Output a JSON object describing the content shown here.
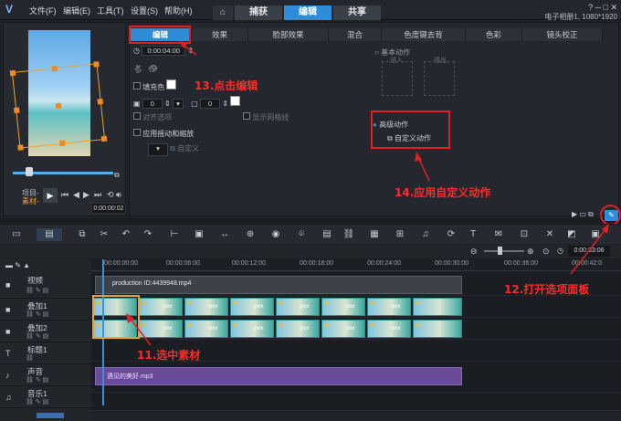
{
  "app": {
    "title_info": "电子相册1, 1080*1920"
  },
  "menu": [
    "文件(F)",
    "编辑(E)",
    "工具(T)",
    "设置(S)",
    "帮助(H)"
  ],
  "main_tabs": [
    "捕获",
    "编辑",
    "共享"
  ],
  "preview": {
    "project_label": "项目-",
    "clip_label": "素材-",
    "timecode": "0:00:00:02"
  },
  "options": {
    "subtabs": [
      "编辑",
      "效果",
      "脸部效果",
      "混合",
      "色度键去背",
      "色彩",
      "镜头校正"
    ],
    "duration": "0:00:04:00",
    "fill_color_label": "填充色",
    "value_a": "0",
    "value_b": "0",
    "align_label": "对齐选项",
    "grid_label": "显示网格线",
    "pan_zoom_label": "应用摇动和缩放",
    "custom_label": "自定义",
    "basic_motion": "基本动作",
    "enter_label": "进入",
    "exit_label": "退出",
    "advanced_motion": "高级动作",
    "custom_motion": "自定义动作"
  },
  "timeline": {
    "timecode": "0:00:33:06",
    "ticks": [
      "00:00:00:00",
      "00:00:06:00",
      "00:00:12:00",
      "00:00:18:00",
      "00:00:24:00",
      "00:00:30:00",
      "00:00:36:00",
      "00:00:42:0"
    ],
    "tracks": [
      "视频",
      "叠加1",
      "叠加2",
      "标题1",
      "声音",
      "音乐1"
    ],
    "video_clip": "production ID:4439948.mp4",
    "audio_clip": "遇见的美好.mp3",
    "thumb_label": "pex"
  },
  "annotations": {
    "a11": "11.选中素材",
    "a12": "12.打开选项面板",
    "a13": "13.点击编辑",
    "a14": "14.应用自定义动作"
  },
  "colors": {
    "accent": "#2f8dd8",
    "annotation": "#e02020",
    "selection": "#f0a030"
  }
}
